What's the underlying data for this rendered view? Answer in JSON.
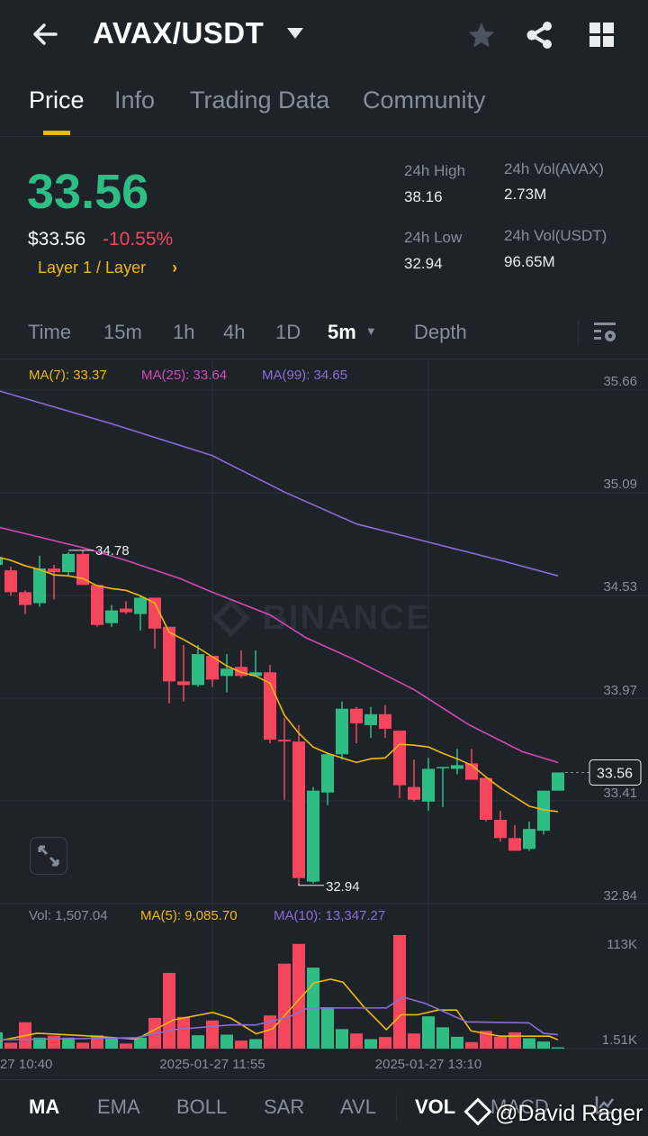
{
  "header": {
    "title": "AVAX/USDT",
    "icons": [
      "back-arrow-icon",
      "caret-down-icon",
      "star-icon",
      "share-icon",
      "grid-icon"
    ]
  },
  "tabs": [
    {
      "label": "Price",
      "active": true
    },
    {
      "label": "Info"
    },
    {
      "label": "Trading Data"
    },
    {
      "label": "Community"
    }
  ],
  "ticker": {
    "last_price": "33.56",
    "usd_price": "$33.56",
    "change": "-10.55%",
    "category": "Layer 1 / Layer",
    "high_label": "24h High",
    "high": "38.16",
    "low_label": "24h Low",
    "low": "32.94",
    "vol_base_label": "24h Vol(AVAX)",
    "vol_base": "2.73M",
    "vol_quote_label": "24h Vol(USDT)",
    "vol_quote": "96.65M"
  },
  "timeframes": [
    {
      "label": "Time"
    },
    {
      "label": "15m"
    },
    {
      "label": "1h"
    },
    {
      "label": "4h"
    },
    {
      "label": "1D"
    },
    {
      "label": "5m",
      "active": true
    },
    {
      "label": "Depth"
    }
  ],
  "legend": {
    "ma7": "MA(7): 33.37",
    "ma25": "MA(25): 33.64",
    "ma99": "MA(99): 34.65"
  },
  "vol_legend": {
    "vol": "Vol: 1,507.04",
    "ma5": "MA(5): 9,085.70",
    "ma10": "MA(10): 13,347.27"
  },
  "colors": {
    "up": "#2ebd85",
    "down": "#f6465d",
    "accent": "#f0b90b",
    "ma7": "#f0b90b",
    "ma25": "#d548b5",
    "ma99": "#8d6cd6",
    "bg": "#1e2329"
  },
  "watermark": "BINANCE",
  "credit": "@David Rager",
  "bottom_indicators": [
    {
      "label": "MA",
      "active": true
    },
    {
      "label": "EMA"
    },
    {
      "label": "BOLL"
    },
    {
      "label": "SAR"
    },
    {
      "label": "AVL"
    },
    {
      "label": "VOL",
      "active": true
    },
    {
      "label": "MACD"
    }
  ],
  "chart_data": {
    "type": "candlestick",
    "price_axis_labels": [
      "35.66",
      "35.09",
      "34.53",
      "33.97",
      "33.41",
      "32.84"
    ],
    "ylim": [
      32.84,
      35.66
    ],
    "current_price": "33.56",
    "high_marker": "34.78",
    "low_marker": "32.94",
    "x_labels": [
      "27 10:40",
      "2025-01-27 11:55",
      "2025-01-27 13:10"
    ],
    "candles": [
      [
        34.7,
        34.72,
        34.68,
        34.74
      ],
      [
        34.67,
        34.69,
        34.53,
        34.55
      ],
      [
        34.55,
        34.56,
        34.43,
        34.48
      ],
      [
        34.49,
        34.75,
        34.47,
        34.68
      ],
      [
        34.68,
        34.7,
        34.51,
        34.66
      ],
      [
        34.66,
        34.77,
        34.64,
        34.76
      ],
      [
        34.76,
        34.78,
        34.59,
        34.59
      ],
      [
        34.59,
        34.59,
        34.36,
        34.37
      ],
      [
        34.38,
        34.48,
        34.36,
        34.45
      ],
      [
        34.46,
        34.5,
        34.43,
        34.44
      ],
      [
        34.43,
        34.53,
        34.34,
        34.52
      ],
      [
        34.52,
        34.52,
        34.24,
        34.35
      ],
      [
        34.36,
        34.36,
        33.94,
        34.06
      ],
      [
        34.06,
        34.26,
        33.95,
        34.04
      ],
      [
        34.04,
        34.26,
        34.03,
        34.21
      ],
      [
        34.2,
        34.2,
        34.03,
        34.07
      ],
      [
        34.09,
        34.21,
        34.0,
        34.13
      ],
      [
        34.14,
        34.23,
        34.08,
        34.09
      ],
      [
        34.09,
        34.23,
        34.09,
        34.11
      ],
      [
        34.11,
        34.15,
        33.72,
        33.74
      ],
      [
        33.74,
        33.86,
        33.41,
        33.73
      ],
      [
        33.73,
        33.82,
        32.94,
        32.98
      ],
      [
        32.96,
        33.48,
        32.95,
        33.46
      ],
      [
        33.45,
        33.67,
        33.38,
        33.66
      ],
      [
        33.66,
        33.95,
        33.63,
        33.91
      ],
      [
        33.91,
        33.92,
        33.72,
        33.83
      ],
      [
        33.82,
        33.92,
        33.75,
        33.88
      ],
      [
        33.88,
        33.93,
        33.75,
        33.8
      ],
      [
        33.79,
        33.79,
        33.42,
        33.49
      ],
      [
        33.48,
        33.63,
        33.4,
        33.41
      ],
      [
        33.4,
        33.64,
        33.35,
        33.58
      ],
      [
        33.585,
        33.59,
        33.37,
        33.59
      ],
      [
        33.58,
        33.69,
        33.55,
        33.6
      ],
      [
        33.61,
        33.69,
        33.52,
        33.52
      ],
      [
        33.53,
        33.53,
        33.29,
        33.3
      ],
      [
        33.3,
        33.35,
        33.18,
        33.2
      ],
      [
        33.2,
        33.27,
        33.13,
        33.13
      ],
      [
        33.14,
        33.29,
        33.13,
        33.25
      ],
      [
        33.24,
        33.46,
        33.22,
        33.46
      ],
      [
        33.46,
        33.56,
        33.46,
        33.56
      ]
    ],
    "candle_format": "open,high,low,close",
    "ma7": [
      34.745,
      34.725,
      34.695,
      34.675,
      34.645,
      34.64,
      34.625,
      34.585,
      34.57,
      34.56,
      34.53,
      34.49,
      34.33,
      34.29,
      34.245,
      34.195,
      34.145,
      34.11,
      34.09,
      34.05,
      33.875,
      33.775,
      33.7,
      33.665,
      33.64,
      33.615,
      33.635,
      33.64,
      33.715,
      33.71,
      33.7,
      33.665,
      33.635,
      33.6,
      33.535,
      33.475,
      33.425,
      33.375,
      33.355,
      33.345
    ],
    "ma25": [
      [
        0,
        34.91
      ],
      [
        6,
        34.795
      ],
      [
        9,
        34.725
      ],
      [
        12.75,
        34.625
      ],
      [
        15,
        34.55
      ],
      [
        19,
        34.425
      ],
      [
        21.5,
        34.3
      ],
      [
        25,
        34.175
      ],
      [
        29,
        34.015
      ],
      [
        32.75,
        33.825
      ],
      [
        36.5,
        33.675
      ],
      [
        39,
        33.615
      ]
    ],
    "ma99": [
      [
        0,
        35.66
      ],
      [
        8,
        35.475
      ],
      [
        15,
        35.3
      ],
      [
        20,
        35.1
      ],
      [
        25,
        34.925
      ],
      [
        30,
        34.825
      ],
      [
        35,
        34.725
      ],
      [
        39,
        34.64
      ]
    ],
    "volume_axis_labels": [
      "113K",
      "1.51K"
    ],
    "volume_k": [
      19.3,
      7.0,
      31.2,
      13.0,
      15.4,
      13.0,
      7.0,
      15.8,
      13.0,
      6.0,
      13.0,
      36.4,
      89.6,
      37.5,
      15.8,
      33.3,
      16.5,
      9.5,
      11.2,
      39.2,
      100.5,
      123.9,
      95.9,
      49.0,
      23.1,
      17.9,
      11.2,
      13.7,
      134.4,
      17.9,
      38.2,
      25.2,
      14.0,
      7.7,
      21.0,
      14.0,
      19.3,
      12.3,
      8.4,
      1.51
    ],
    "vol_ma5_k": [
      [
        0.25,
        9.5
      ],
      [
        2.83,
        18.2
      ],
      [
        5.99,
        15.4
      ],
      [
        9.72,
        11.2
      ],
      [
        12.3,
        34.0
      ],
      [
        15.03,
        42.8
      ],
      [
        16.3,
        35.8
      ],
      [
        18.04,
        17.5
      ],
      [
        19.19,
        23.5
      ],
      [
        22.06,
        77.8
      ],
      [
        23.2,
        82.1
      ],
      [
        24.07,
        78.6
      ],
      [
        25.5,
        49.8
      ],
      [
        27.08,
        22.4
      ],
      [
        28.1,
        40.0
      ],
      [
        29.23,
        40.0
      ],
      [
        30.67,
        45.6
      ],
      [
        31.96,
        45.6
      ],
      [
        32.96,
        21.0
      ],
      [
        34.97,
        14.7
      ],
      [
        38.4,
        14.7
      ],
      [
        38.99,
        10.5
      ]
    ],
    "vol_ma10_k": [
      [
        0.25,
        10.5
      ],
      [
        9.72,
        12.9
      ],
      [
        12.3,
        22.4
      ],
      [
        16.3,
        28.1
      ],
      [
        18.04,
        28.1
      ],
      [
        20.34,
        37.6
      ],
      [
        21.63,
        48.1
      ],
      [
        27.08,
        48.1
      ],
      [
        28.23,
        61.0
      ],
      [
        29.81,
        53.3
      ],
      [
        32.68,
        31.6
      ],
      [
        36.98,
        30.5
      ],
      [
        37.99,
        18.2
      ],
      [
        38.99,
        16.5
      ]
    ]
  }
}
